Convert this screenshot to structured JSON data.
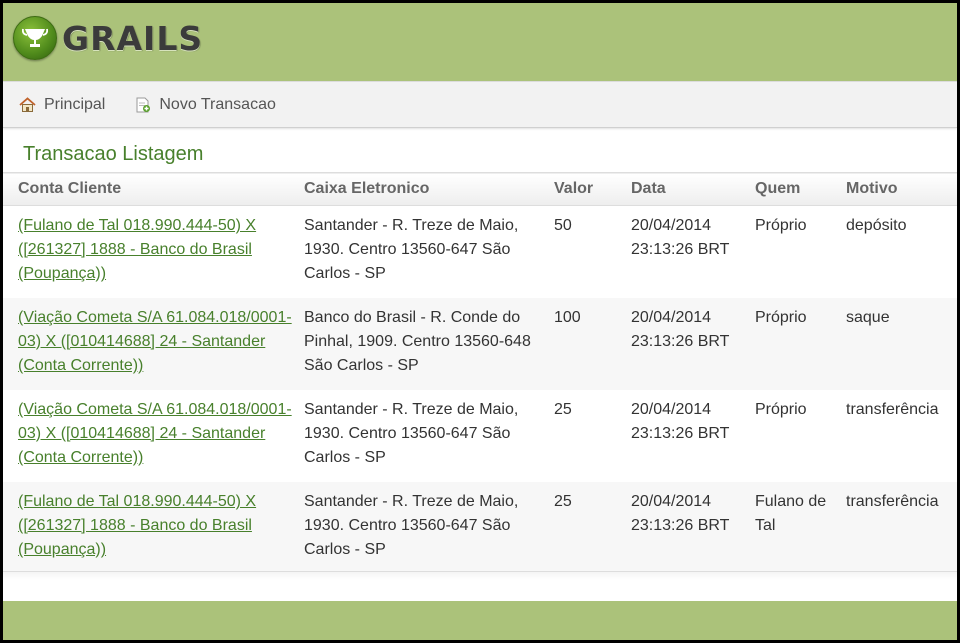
{
  "header": {
    "logo_text": "GRAILS"
  },
  "nav": {
    "items": [
      {
        "label": "Principal",
        "icon": "home-icon"
      },
      {
        "label": "Novo Transacao",
        "icon": "new-document-icon"
      }
    ]
  },
  "main": {
    "title": "Transacao Listagem",
    "columns": [
      "Conta Cliente",
      "Caixa Eletronico",
      "Valor",
      "Data",
      "Quem",
      "Motivo"
    ],
    "rows": [
      {
        "conta": "(Fulano de Tal 018.990.444-50) X ([261327] 1888 - Banco do Brasil (Poupança))",
        "caixa": "Santander - R. Treze de Maio, 1930. Centro 13560-647 São Carlos - SP",
        "valor": "50",
        "data": "20/04/2014 23:13:26 BRT",
        "quem": "Próprio",
        "motivo": "depósito"
      },
      {
        "conta": "(Viação Cometa S/A 61.084.018/0001-03) X ([010414688] 24 - Santander (Conta Corrente))",
        "caixa": "Banco do Brasil - R. Conde do Pinhal, 1909. Centro 13560-648 São Carlos - SP",
        "valor": "100",
        "data": "20/04/2014 23:13:26 BRT",
        "quem": "Próprio",
        "motivo": "saque"
      },
      {
        "conta": "(Viação Cometa S/A 61.084.018/0001-03) X ([010414688] 24 - Santander (Conta Corrente))",
        "caixa": "Santander - R. Treze de Maio, 1930. Centro 13560-647 São Carlos - SP",
        "valor": "25",
        "data": "20/04/2014 23:13:26 BRT",
        "quem": "Próprio",
        "motivo": "transferência"
      },
      {
        "conta": "(Fulano de Tal 018.990.444-50) X ([261327] 1888 - Banco do Brasil (Poupança))",
        "caixa": "Santander - R. Treze de Maio, 1930. Centro 13560-647 São Carlos - SP",
        "valor": "25",
        "data": "20/04/2014 23:13:26 BRT",
        "quem": "Fulano de Tal",
        "motivo": "transferência"
      }
    ]
  },
  "colors": {
    "header_bg": "#abc27a",
    "link": "#48802c",
    "title": "#48802c"
  }
}
